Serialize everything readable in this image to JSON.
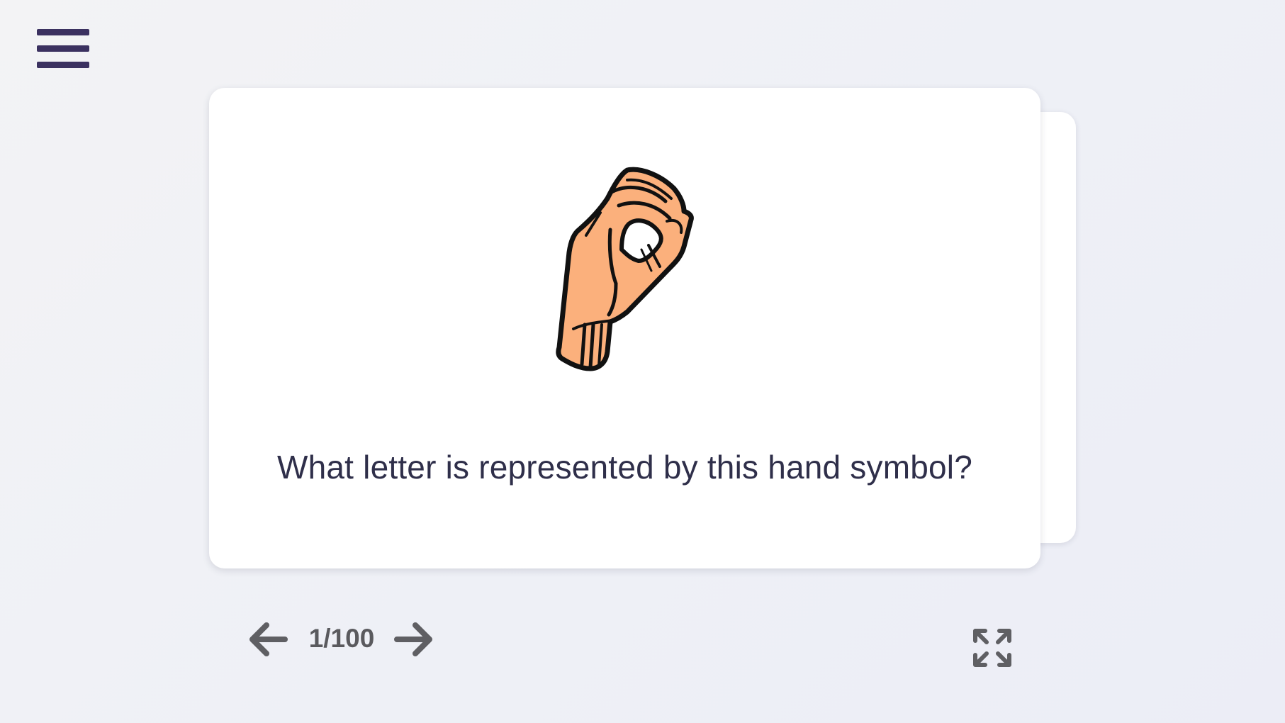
{
  "header": {
    "menu_icon": "hamburger-menu-icon",
    "menu_color": "#3b3160"
  },
  "flashcard": {
    "image_icon": "asl-hand-sign-o-image",
    "question": "What letter is represented by this hand symbol?"
  },
  "navigation": {
    "prev_icon": "arrow-left-icon",
    "counter": "1/100",
    "next_icon": "arrow-right-icon",
    "fullscreen_icon": "expand-icon",
    "icon_color": "#5f5f63"
  }
}
